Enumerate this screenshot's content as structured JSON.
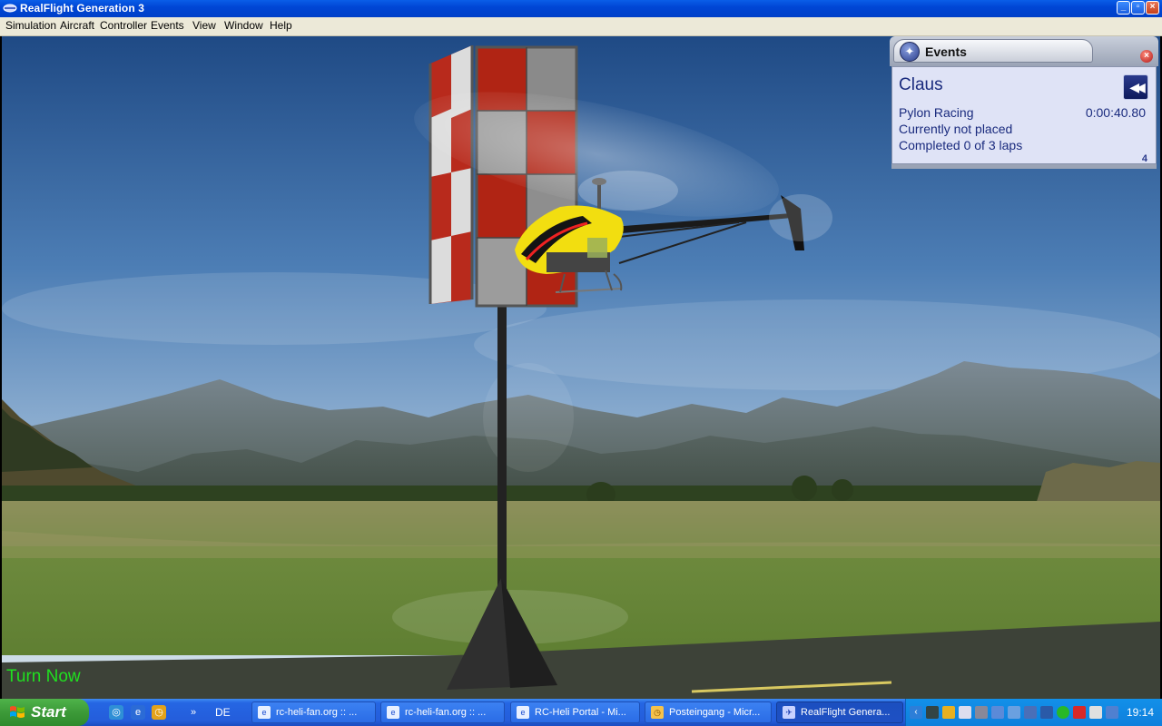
{
  "window": {
    "title": "RealFlight Generation 3"
  },
  "menu": [
    "Simulation",
    "Aircraft",
    "Controller",
    "Events",
    "View",
    "Window",
    "Help"
  ],
  "events_panel": {
    "title": "Events",
    "pilot": "Claus",
    "event_name": "Pylon Racing",
    "time": "0:00:40.80",
    "placement": "Currently not placed",
    "laps": "Completed 0 of 3 laps",
    "page": "4"
  },
  "hud": {
    "prompt": "Turn Now"
  },
  "taskbar": {
    "start_label": "Start",
    "language": "DE",
    "tasks": [
      {
        "label": "rc-heli-fan.org :: ...",
        "icon": "ie-icon"
      },
      {
        "label": "rc-heli-fan.org :: ...",
        "icon": "ie-icon"
      },
      {
        "label": "RC-Heli Portal - Mi...",
        "icon": "ie-icon"
      },
      {
        "label": "Posteingang - Micr...",
        "icon": "outlook-icon"
      },
      {
        "label": "RealFlight Genera...",
        "icon": "realflight-icon",
        "active": true
      }
    ],
    "clock": "19:14"
  },
  "colors": {
    "titlebar": "#0046d5",
    "taskbar": "#245ddb",
    "start": "#3c9a38",
    "hud_text": "#20e020",
    "events_text": "#1a2b7e",
    "pylon_red": "#a82010",
    "sky_top": "#1e4a86",
    "grass": "#6f8a3a"
  }
}
